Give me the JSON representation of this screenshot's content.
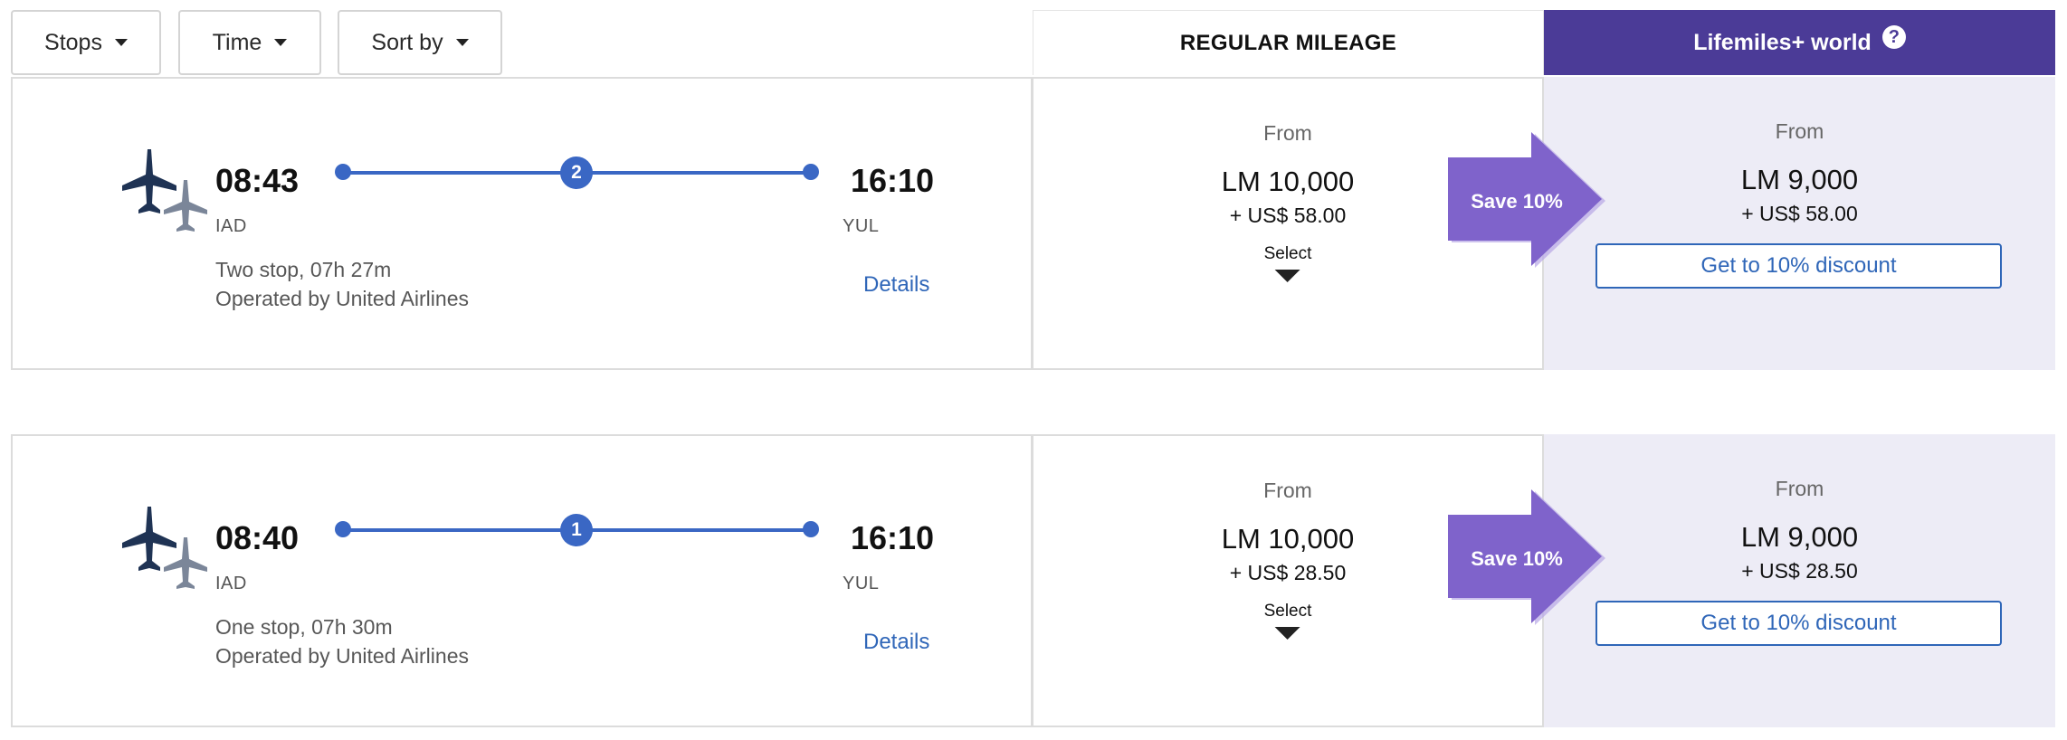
{
  "filters": {
    "stops": "Stops",
    "time": "Time",
    "sort": "Sort by"
  },
  "columns": {
    "regular": "REGULAR MILEAGE",
    "plus": "Lifemiles+ world",
    "help": "?"
  },
  "colors": {
    "plus_header": "#4b3b97",
    "route": "#3a67c4",
    "save_badge": "#7f63cb",
    "plus_column_bg": "#edecf6"
  },
  "flights": [
    {
      "depart_time": "08:43",
      "depart_airport": "IAD",
      "arrive_time": "16:10",
      "arrive_airport": "YUL",
      "stops_count": "2",
      "summary": "Two stop, 07h 27m",
      "operator": "Operated by United Airlines",
      "details": "Details",
      "regular": {
        "from": "From",
        "miles": "LM 10,000",
        "cash": "+ US$ 58.00",
        "select": "Select"
      },
      "save": "Save 10%",
      "plus": {
        "from": "From",
        "miles": "LM 9,000",
        "cash": "+ US$ 58.00",
        "cta": "Get to 10% discount"
      }
    },
    {
      "depart_time": "08:40",
      "depart_airport": "IAD",
      "arrive_time": "16:10",
      "arrive_airport": "YUL",
      "stops_count": "1",
      "summary": "One stop, 07h 30m",
      "operator": "Operated by United Airlines",
      "details": "Details",
      "regular": {
        "from": "From",
        "miles": "LM 10,000",
        "cash": "+ US$ 28.50",
        "select": "Select"
      },
      "save": "Save 10%",
      "plus": {
        "from": "From",
        "miles": "LM 9,000",
        "cash": "+ US$ 28.50",
        "cta": "Get to 10% discount"
      }
    }
  ]
}
